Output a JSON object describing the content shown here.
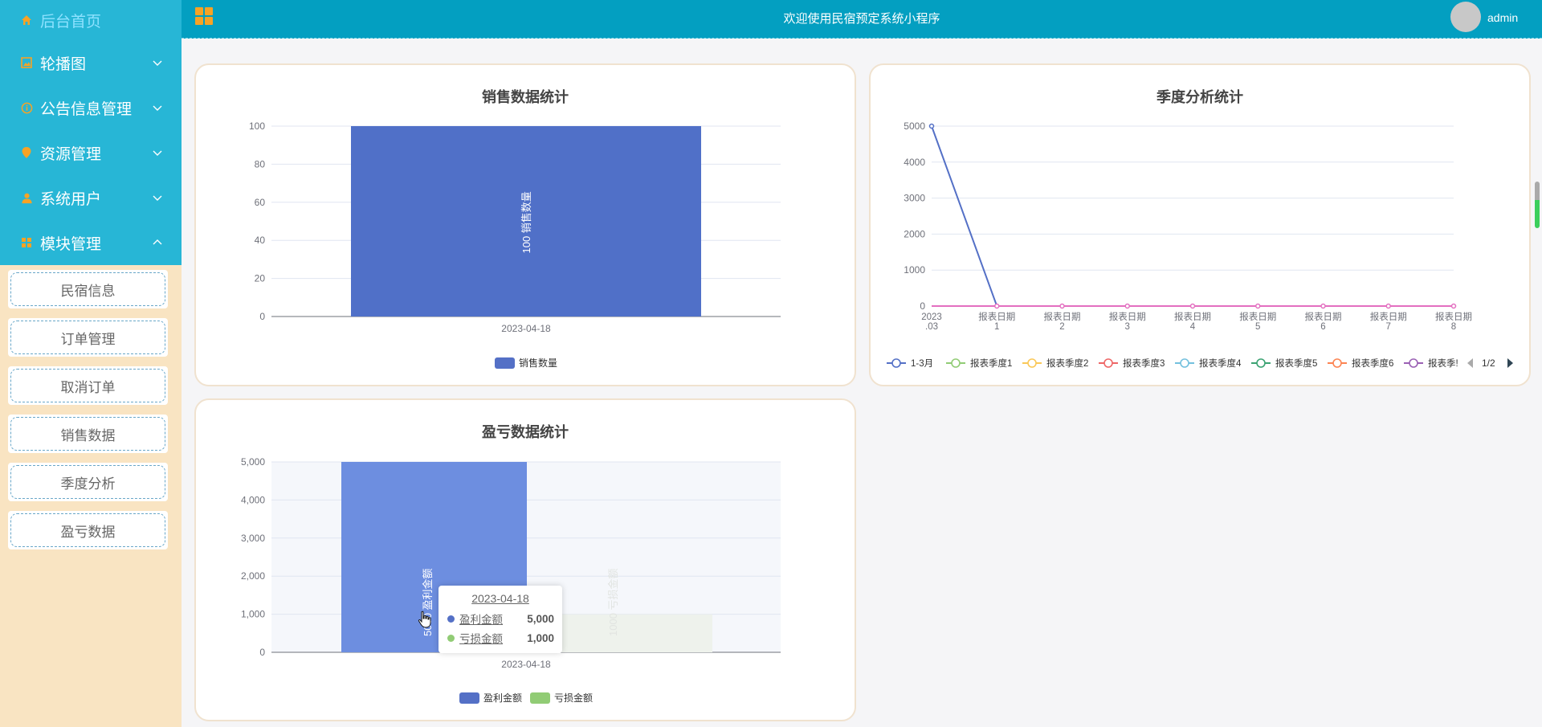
{
  "sidebar": {
    "home": "后台首页",
    "items": [
      {
        "label": "轮播图"
      },
      {
        "label": "公告信息管理"
      },
      {
        "label": "资源管理"
      },
      {
        "label": "系统用户"
      },
      {
        "label": "模块管理"
      }
    ],
    "submenu": [
      {
        "label": "民宿信息"
      },
      {
        "label": "订单管理"
      },
      {
        "label": "取消订单"
      },
      {
        "label": "销售数据"
      },
      {
        "label": "季度分析"
      },
      {
        "label": "盈亏数据"
      }
    ]
  },
  "header": {
    "title": "欢迎使用民宿预定系统小程序",
    "username": "admin"
  },
  "colors": {
    "sidebar_top": "#27b6d6",
    "sidebar_bg": "#f9e4c2",
    "header_bg": "#039fc1",
    "series_blue": "#5470c6",
    "series_green": "#91cc75"
  },
  "chart_data": [
    {
      "id": "sales",
      "type": "bar",
      "title": "销售数据统计",
      "categories": [
        "2023-04-18"
      ],
      "series": [
        {
          "name": "销售数量",
          "values": [
            100
          ],
          "label": "100  销售数量"
        }
      ],
      "ylim": [
        0,
        100
      ],
      "yticks": [
        "0",
        "20",
        "40",
        "60",
        "80",
        "100"
      ],
      "legend_position": "bottom-center",
      "grid": true
    },
    {
      "id": "quarter",
      "type": "line",
      "title": "季度分析统计",
      "x": [
        [
          "2023",
          ".03"
        ],
        [
          "报表日期",
          "1"
        ],
        [
          "报表日期",
          "2"
        ],
        [
          "报表日期",
          "3"
        ],
        [
          "报表日期",
          "4"
        ],
        [
          "报表日期",
          "5"
        ],
        [
          "报表日期",
          "6"
        ],
        [
          "报表日期",
          "7"
        ],
        [
          "报表日期",
          "8"
        ]
      ],
      "series": [
        {
          "name": "1-3月",
          "values": [
            5000,
            0,
            0,
            0,
            0,
            0,
            0,
            0,
            0
          ],
          "color": "#5470c6"
        },
        {
          "name": "报表季度1",
          "values": [
            0,
            0,
            0,
            0,
            0,
            0,
            0,
            0,
            0
          ],
          "color": "#91cc75"
        },
        {
          "name": "报表季度2",
          "values": [
            0,
            0,
            0,
            0,
            0,
            0,
            0,
            0,
            0
          ],
          "color": "#fac858"
        },
        {
          "name": "报表季度3",
          "values": [
            0,
            0,
            0,
            0,
            0,
            0,
            0,
            0,
            0
          ],
          "color": "#ee6666"
        },
        {
          "name": "报表季度4",
          "values": [
            0,
            0,
            0,
            0,
            0,
            0,
            0,
            0,
            0
          ],
          "color": "#73c0de"
        },
        {
          "name": "报表季度5",
          "values": [
            0,
            0,
            0,
            0,
            0,
            0,
            0,
            0,
            0
          ],
          "color": "#3ba272"
        },
        {
          "name": "报表季度6",
          "values": [
            0,
            0,
            0,
            0,
            0,
            0,
            0,
            0,
            0
          ],
          "color": "#fc8452"
        },
        {
          "name": "报表季!",
          "values": [
            0,
            0,
            0,
            0,
            0,
            0,
            0,
            0,
            0
          ],
          "color": "#9a60b4"
        }
      ],
      "top_series_color": "#e36fc0",
      "ylim": [
        0,
        5000
      ],
      "yticks": [
        "0",
        "1000",
        "2000",
        "3000",
        "4000",
        "5000"
      ],
      "legend_position": "bottom",
      "legend_page": "1/2",
      "grid": true
    },
    {
      "id": "profit",
      "type": "bar",
      "title": "盈亏数据统计",
      "categories": [
        "2023-04-18"
      ],
      "series": [
        {
          "name": "盈利金额",
          "values": [
            5000
          ],
          "label": "5000  盈利金额",
          "color": "#5470c6"
        },
        {
          "name": "亏损金额",
          "values": [
            1000
          ],
          "label": "1000  亏损金额",
          "color": "#91cc75"
        }
      ],
      "ylim": [
        0,
        5000
      ],
      "yticks": [
        "0",
        "1,000",
        "2,000",
        "3,000",
        "4,000",
        "5,000"
      ],
      "legend_position": "bottom-center",
      "grid": true,
      "tooltip": {
        "title": "2023-04-18",
        "rows": [
          {
            "name": "盈利金额",
            "value": "5,000"
          },
          {
            "name": "亏损金额",
            "value": "1,000"
          }
        ]
      }
    }
  ]
}
